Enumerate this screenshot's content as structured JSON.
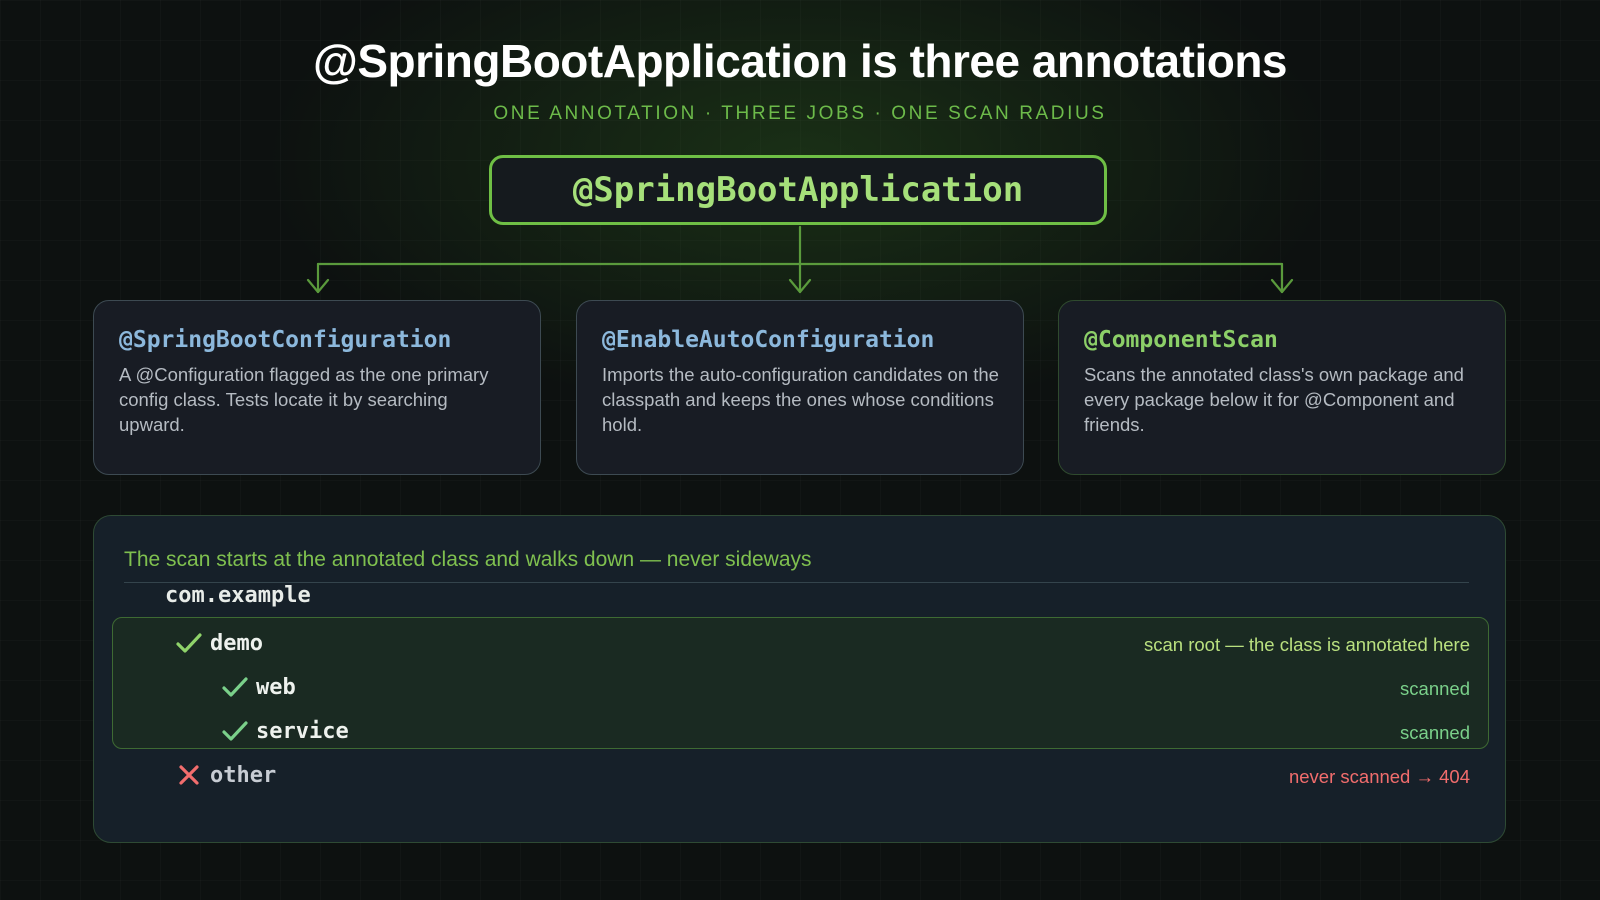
{
  "title": "@SpringBootApplication is three annotations",
  "subtitle": "ONE ANNOTATION · THREE JOBS · ONE SCAN RADIUS",
  "root": {
    "label": "@SpringBootApplication"
  },
  "cards": [
    {
      "title": "@SpringBootConfiguration",
      "description": "A @Configuration flagged as the one primary config class. Tests locate it by searching upward."
    },
    {
      "title": "@EnableAutoConfiguration",
      "description": "Imports the auto-configuration candidates on the classpath and keeps the ones whose conditions hold."
    },
    {
      "title": "@ComponentScan",
      "description": "Scans the annotated class's own package and every package below it for @Component and friends."
    }
  ],
  "scan": {
    "header": "The scan starts at the annotated class and walks down — never sideways",
    "root_package": "com.example",
    "packages": [
      {
        "name": "demo",
        "status": "scanned",
        "note": "scan root — the class is annotated here",
        "icon": "check-icon"
      },
      {
        "name": "web",
        "status": "scanned",
        "note": "scanned",
        "icon": "check-icon"
      },
      {
        "name": "service",
        "status": "scanned",
        "note": "scanned",
        "icon": "check-icon"
      },
      {
        "name": "other",
        "status": "not-scanned",
        "note": "never scanned → 404",
        "icon": "cross-icon"
      }
    ]
  },
  "colors": {
    "accent_green": "#6fbf45",
    "code_green": "#a6e07a",
    "code_blue": "#8cb8dc",
    "check_green": "#8fd36a",
    "scanned_note": "#7ad08a",
    "root_note": "#b9e07f",
    "error_red": "#f26d6d"
  }
}
